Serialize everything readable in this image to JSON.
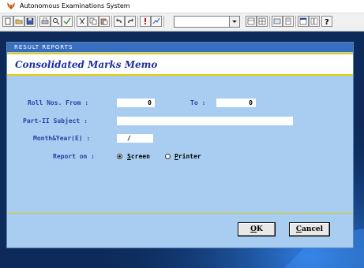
{
  "window": {
    "title": "Autonomous Examinations System"
  },
  "toolbar": {
    "icons": [
      "new-icon",
      "open-icon",
      "save-icon",
      "print-icon",
      "print-preview-icon",
      "spell-icon",
      "cut-icon",
      "copy-icon",
      "paste-icon",
      "undo-icon",
      "redo-icon",
      "exclamation-icon",
      "chart-icon",
      "combo",
      "view-icon",
      "grid-icon",
      "form-icon",
      "report-icon",
      "window-icon",
      "tile-icon",
      "help-icon"
    ],
    "combo_value": ""
  },
  "dialog": {
    "caption": "RESULT REPORTS",
    "banner": "Consolidated Marks Memo",
    "roll_from_label": "Roll Nos. From :",
    "roll_from_value": "0",
    "to_label": "To :",
    "to_value": "0",
    "subject_label": "Part-II Subject :",
    "subject_value": "",
    "month_label": "Month&Year(E) :",
    "month_value": "/",
    "report_label": "Report on :",
    "options": {
      "screen_prefix": "",
      "screen_hot": "S",
      "screen_rest": "creen",
      "printer_hot": "P",
      "printer_rest": "rinter",
      "selected": "screen"
    },
    "ok": {
      "hot": "O",
      "rest": "K"
    },
    "cancel": {
      "hot": "C",
      "rest": "ancel"
    }
  },
  "colors": {
    "dialog_bg": "#a9cdf0",
    "header_bar": "#3a6fbf",
    "banner_text": "#1c2fa3",
    "label_text": "#2840a8",
    "accent_line": "#e8d000",
    "desktop": "#0d2a5a"
  }
}
